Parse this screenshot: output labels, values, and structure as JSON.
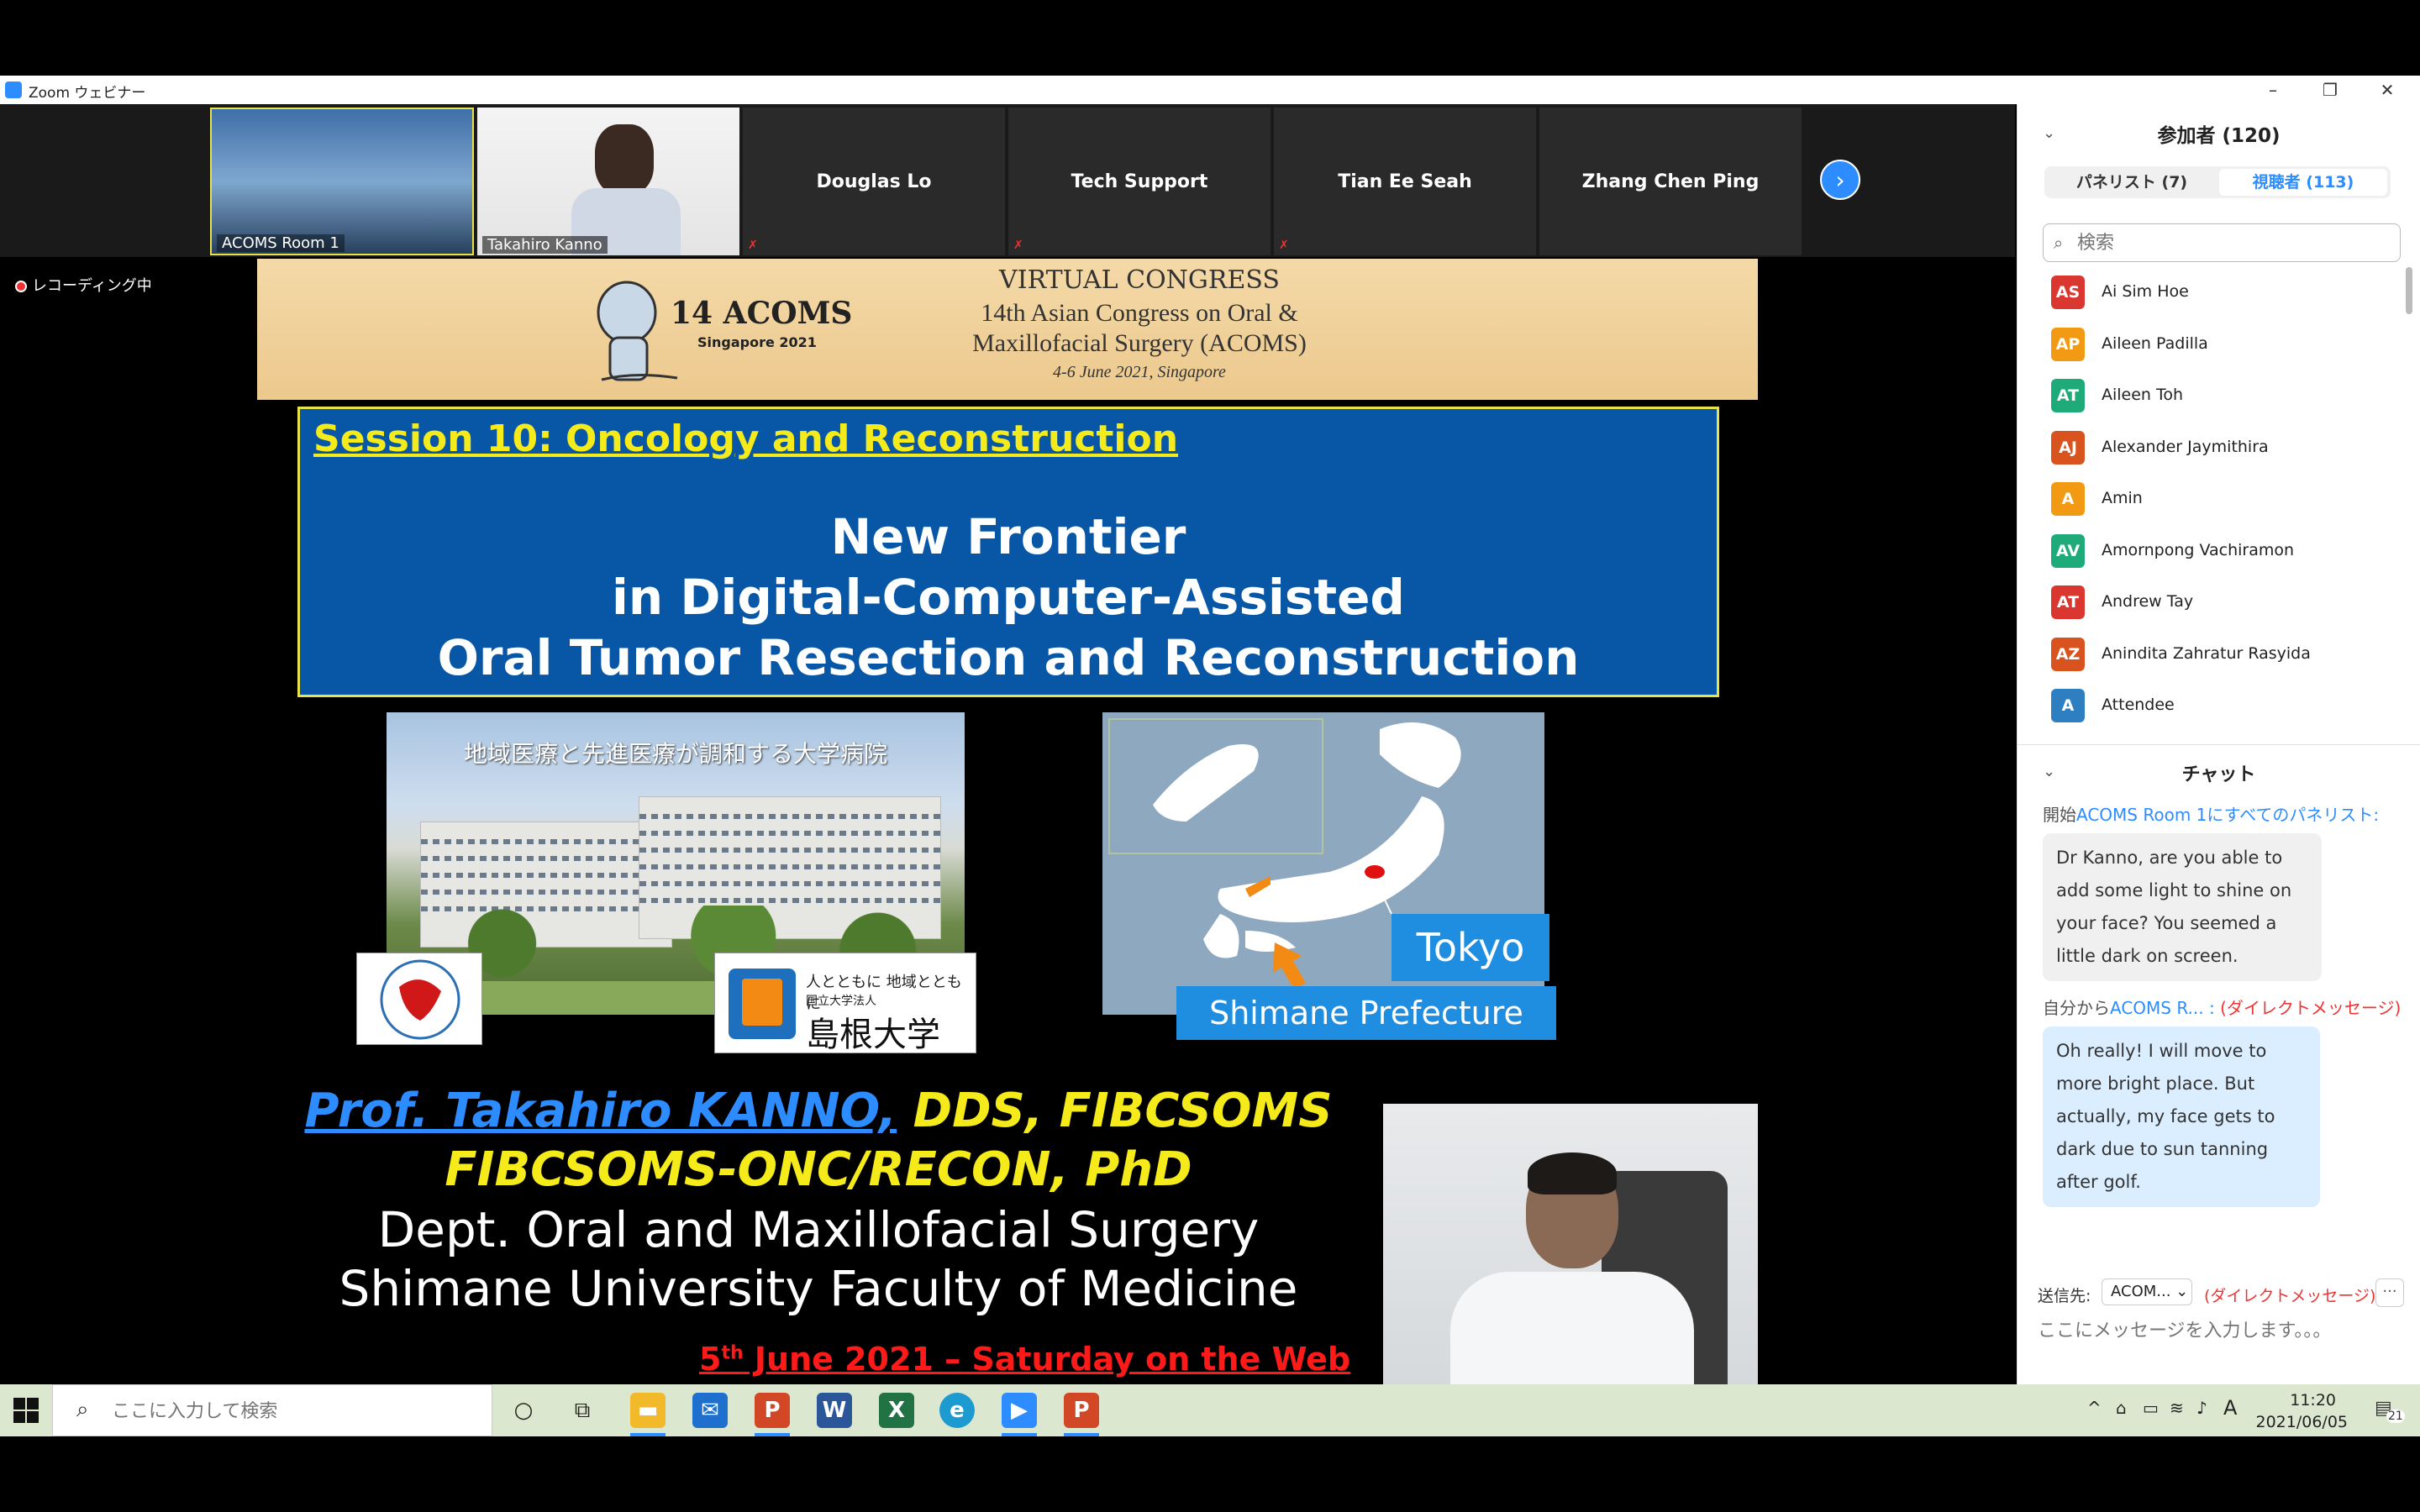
{
  "window": {
    "title": "Zoom ウェビナー",
    "min": "–",
    "restore": "❐",
    "close": "✕"
  },
  "gallery": {
    "tiles": [
      {
        "label": "ACOMS Room 1"
      },
      {
        "label": "Takahiro Kanno"
      },
      {
        "name": "Douglas Lo"
      },
      {
        "name": "Tech Support"
      },
      {
        "name": "Tian Ee Seah"
      },
      {
        "name": "Zhang Chen Ping"
      }
    ],
    "next_icon": "›"
  },
  "recording": "レコーディング中",
  "slide": {
    "banner": {
      "acoms": "14 ACOMS",
      "acoms_sup": "th",
      "singapore": "Singapore 2021",
      "virtual": "VIRTUAL CONGRESS",
      "congress_line1": "14th Asian Congress on Oral &",
      "congress_line2": "Maxillofacial Surgery (ACOMS)",
      "congress_line3": "4-6 June 2021, Singapore"
    },
    "session": "Session 10: Oncology and Reconstruction",
    "title_lines": [
      "New Frontier",
      "in Digital-Computer-Assisted",
      "Oral Tumor Resection and Reconstruction"
    ],
    "hospital_caption": "地域医療と先進医療が調和する大学病院",
    "univ_logo": {
      "tag": "人とともに 地域とともに",
      "sub": "国立大学法人",
      "name": "島根大学"
    },
    "map_tokyo": "Tokyo",
    "map_shimane": "Shimane Prefecture",
    "prof_name": "Prof. Takahiro KANNO,",
    "prof_degrees": " DDS, FIBCSOMS",
    "fib_line": "FIBCSOMS-ONC/RECON, PhD",
    "dept": "Dept. Oral and Maxillofacial Surgery",
    "univ": "Shimane University Faculty of Medicine",
    "date_day": "5",
    "date_sup": "th",
    "date_rest": " June 2021 – Saturday on the Web"
  },
  "panel": {
    "participants_title": "参加者 (120)",
    "tab_panelists": "パネリスト (7)",
    "tab_attendees": "視聴者 (113)",
    "search_placeholder": "検索",
    "participants": [
      {
        "initials": "AS",
        "name": "Ai Sim Hoe",
        "color": "#d9372f"
      },
      {
        "initials": "AP",
        "name": "Aileen Padilla",
        "color": "#f29a14"
      },
      {
        "initials": "AT",
        "name": "Aileen Toh",
        "color": "#1faa7a"
      },
      {
        "initials": "AJ",
        "name": "Alexander Jaymithira",
        "color": "#d9531e"
      },
      {
        "initials": "A",
        "name": "Amin",
        "color": "#f29a14"
      },
      {
        "initials": "AV",
        "name": "Amornpong Vachiramon",
        "color": "#1faa7a"
      },
      {
        "initials": "AT",
        "name": "Andrew Tay",
        "color": "#d9372f"
      },
      {
        "initials": "AZ",
        "name": "Anindita Zahratur Rasyida",
        "color": "#d9531e"
      },
      {
        "initials": "A",
        "name": "Attendee",
        "color": "#2d7fc1"
      }
    ],
    "chat_title": "チャット",
    "chat_from_prefix": "開始",
    "chat_from_name": "ACOMS Room 1",
    "chat_from_suffix": "にすべてのパネリスト:",
    "msg1": "Dr Kanno, are you able to add some light to shine on your face? You seemed a little dark on screen.",
    "me_prefix": "自分から",
    "me_to": "ACOMS R... :",
    "me_dm": "(ダイレクトメッセージ)",
    "msg2": "Oh really! I will move to more bright place. But actually, my face gets to dark due to sun tanning after golf.",
    "send_to_label": "送信先:",
    "send_to_value": "ACOM...",
    "send_dm": "(ダイレクトメッセージ)",
    "more": "···",
    "msg_placeholder": "ここにメッセージを入力します。。。"
  },
  "taskbar": {
    "search_placeholder": "ここに入力して検索",
    "time": "11:20",
    "date": "2021/06/05",
    "notif_count": "21",
    "ime": "A"
  }
}
